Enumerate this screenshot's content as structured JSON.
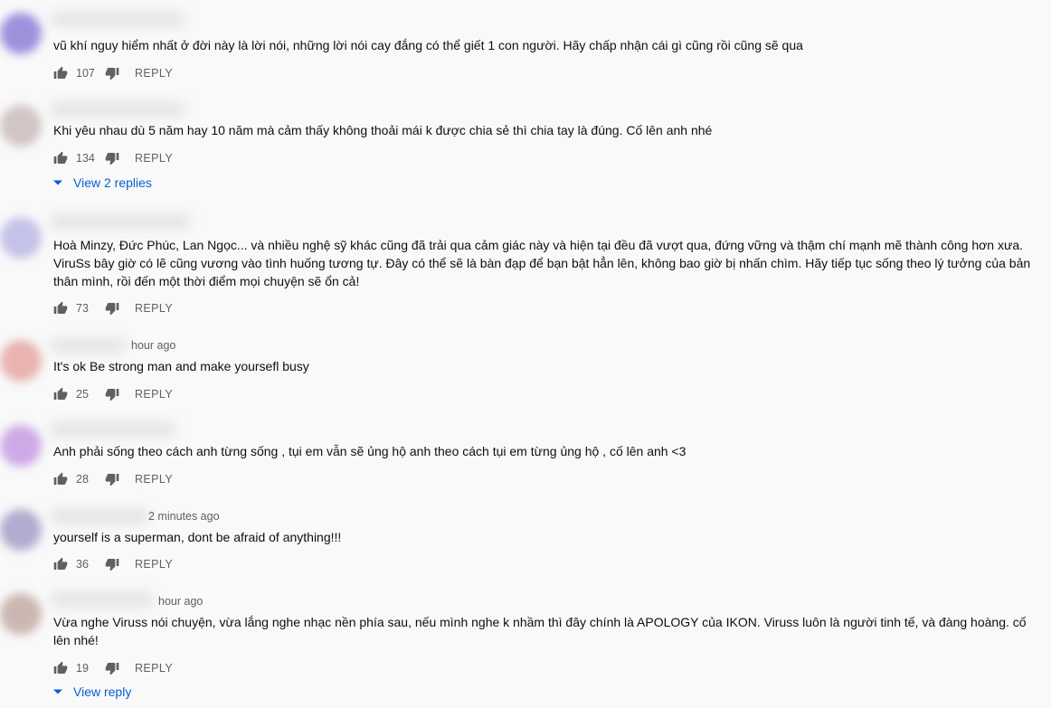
{
  "actions": {
    "reply_label": "REPLY"
  },
  "comments": [
    {
      "meta": "",
      "text": "vũ khí nguy hiểm nhất ở đời này là lời nói, những lời nói cay đắng có thể giết 1 con người. Hãy chấp nhận cái gì cũng rồi cũng sẽ qua",
      "likes": "107",
      "view_replies": "",
      "avatar_color": "#8e7fd8"
    },
    {
      "meta": "",
      "text": "Khi yêu nhau dù 5 năm hay 10 năm mà cảm thấy không thoải mái k được chia sẻ thì chia tay là đúng. Cố lên anh nhé",
      "likes": "134",
      "view_replies": "View 2 replies",
      "avatar_color": "#cbbcbc"
    },
    {
      "meta": "",
      "text": "Hoà Minzy, Đức Phúc, Lan Ngọc... và nhiều nghệ sỹ khác cũng đã trải qua cảm giác này và hiện tại đều đã vượt qua, đứng vững và thậm chí mạnh mẽ thành công hơn xưa. ViruSs bây giờ có lẽ cũng vương vào tình huống tương tự. Đây có thể sẽ là bàn đạp để bạn bật hẳn lên, không bao giờ bị nhấn chìm. Hãy tiếp tục sống theo lý tưởng của bản thân mình, rồi đến một thời điểm mọi chuyện sẽ ổn cả!",
      "likes": "73",
      "view_replies": "",
      "avatar_color": "#bcb8e6"
    },
    {
      "meta": "hour ago",
      "text": "It's ok Be strong man and make yoursefl busy",
      "likes": "25",
      "view_replies": "",
      "avatar_color": "#e7a7a3"
    },
    {
      "meta": "",
      "text": "Anh phải sống theo cách anh từng sống , tụi em vẫn sẽ ủng hộ anh theo cách tụi em từng ủng hộ , cố lên anh <3",
      "likes": "28",
      "view_replies": "",
      "avatar_color": "#c79ce4"
    },
    {
      "meta": "2 minutes ago",
      "text": "yourself is a superman, dont be afraid of anything!!!",
      "likes": "36",
      "view_replies": "",
      "avatar_color": "#a79ec9"
    },
    {
      "meta": "hour ago",
      "text": "Vừa nghe Viruss nói chuyện, vừa lắng nghe nhạc nền phía sau, nếu mình nghe k nhầm thì đây chính là APOLOGY của IKON. Viruss luôn là người tinh tế, và đàng hoàng. cố lên nhé!",
      "likes": "19",
      "view_replies": "View reply",
      "avatar_color": "#c3aca5"
    }
  ]
}
